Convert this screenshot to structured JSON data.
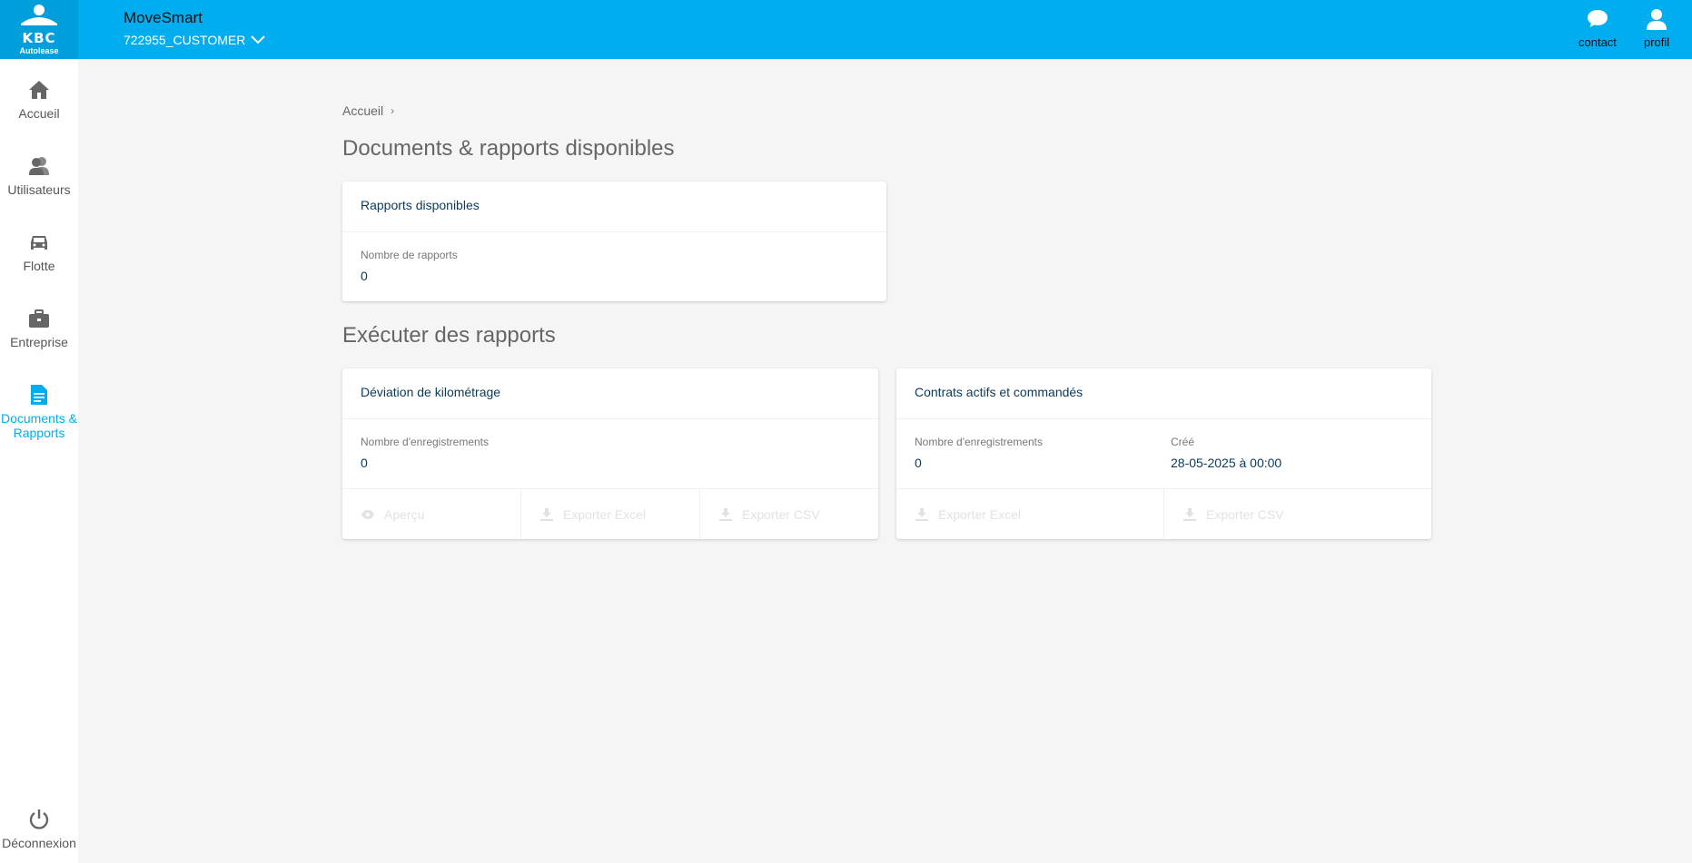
{
  "header": {
    "logo_text": "KBC",
    "logo_sub": "Autolease",
    "app_title": "MoveSmart",
    "customer": "722955_CUSTOMER",
    "contact_label": "contact",
    "profil_label": "profil"
  },
  "sidebar": {
    "items": [
      {
        "label": "Accueil",
        "icon": "home-icon"
      },
      {
        "label": "Utilisateurs",
        "icon": "users-icon"
      },
      {
        "label": "Flotte",
        "icon": "car-icon"
      },
      {
        "label": "Entreprise",
        "icon": "briefcase-icon"
      },
      {
        "label": "Documents & Rapports",
        "icon": "document-icon",
        "active": true
      }
    ],
    "logout_label": "Déconnexion"
  },
  "breadcrumb": {
    "home": "Accueil"
  },
  "sections": {
    "available_title": "Documents & rapports disponibles",
    "execute_title": "Exécuter des rapports"
  },
  "available_card": {
    "title": "Rapports disponibles",
    "count_label": "Nombre de rapports",
    "count_value": "0"
  },
  "report_cards": [
    {
      "title": "Déviation de kilométrage",
      "records_label": "Nombre d'enregistrements",
      "records_value": "0",
      "actions": [
        "Aperçu",
        "Exporter Excel",
        "Exporter CSV"
      ]
    },
    {
      "title": "Contrats actifs et commandés",
      "records_label": "Nombre d'enregistrements",
      "records_value": "0",
      "created_label": "Créé",
      "created_value": "28-05-2025 à 00:00",
      "actions": [
        "Exporter Excel",
        "Exporter CSV"
      ]
    }
  ],
  "colors": {
    "brand": "#00aeef",
    "logo_bg": "#009fdc",
    "active": "#00aeef",
    "value_text": "#0a3a5a"
  }
}
